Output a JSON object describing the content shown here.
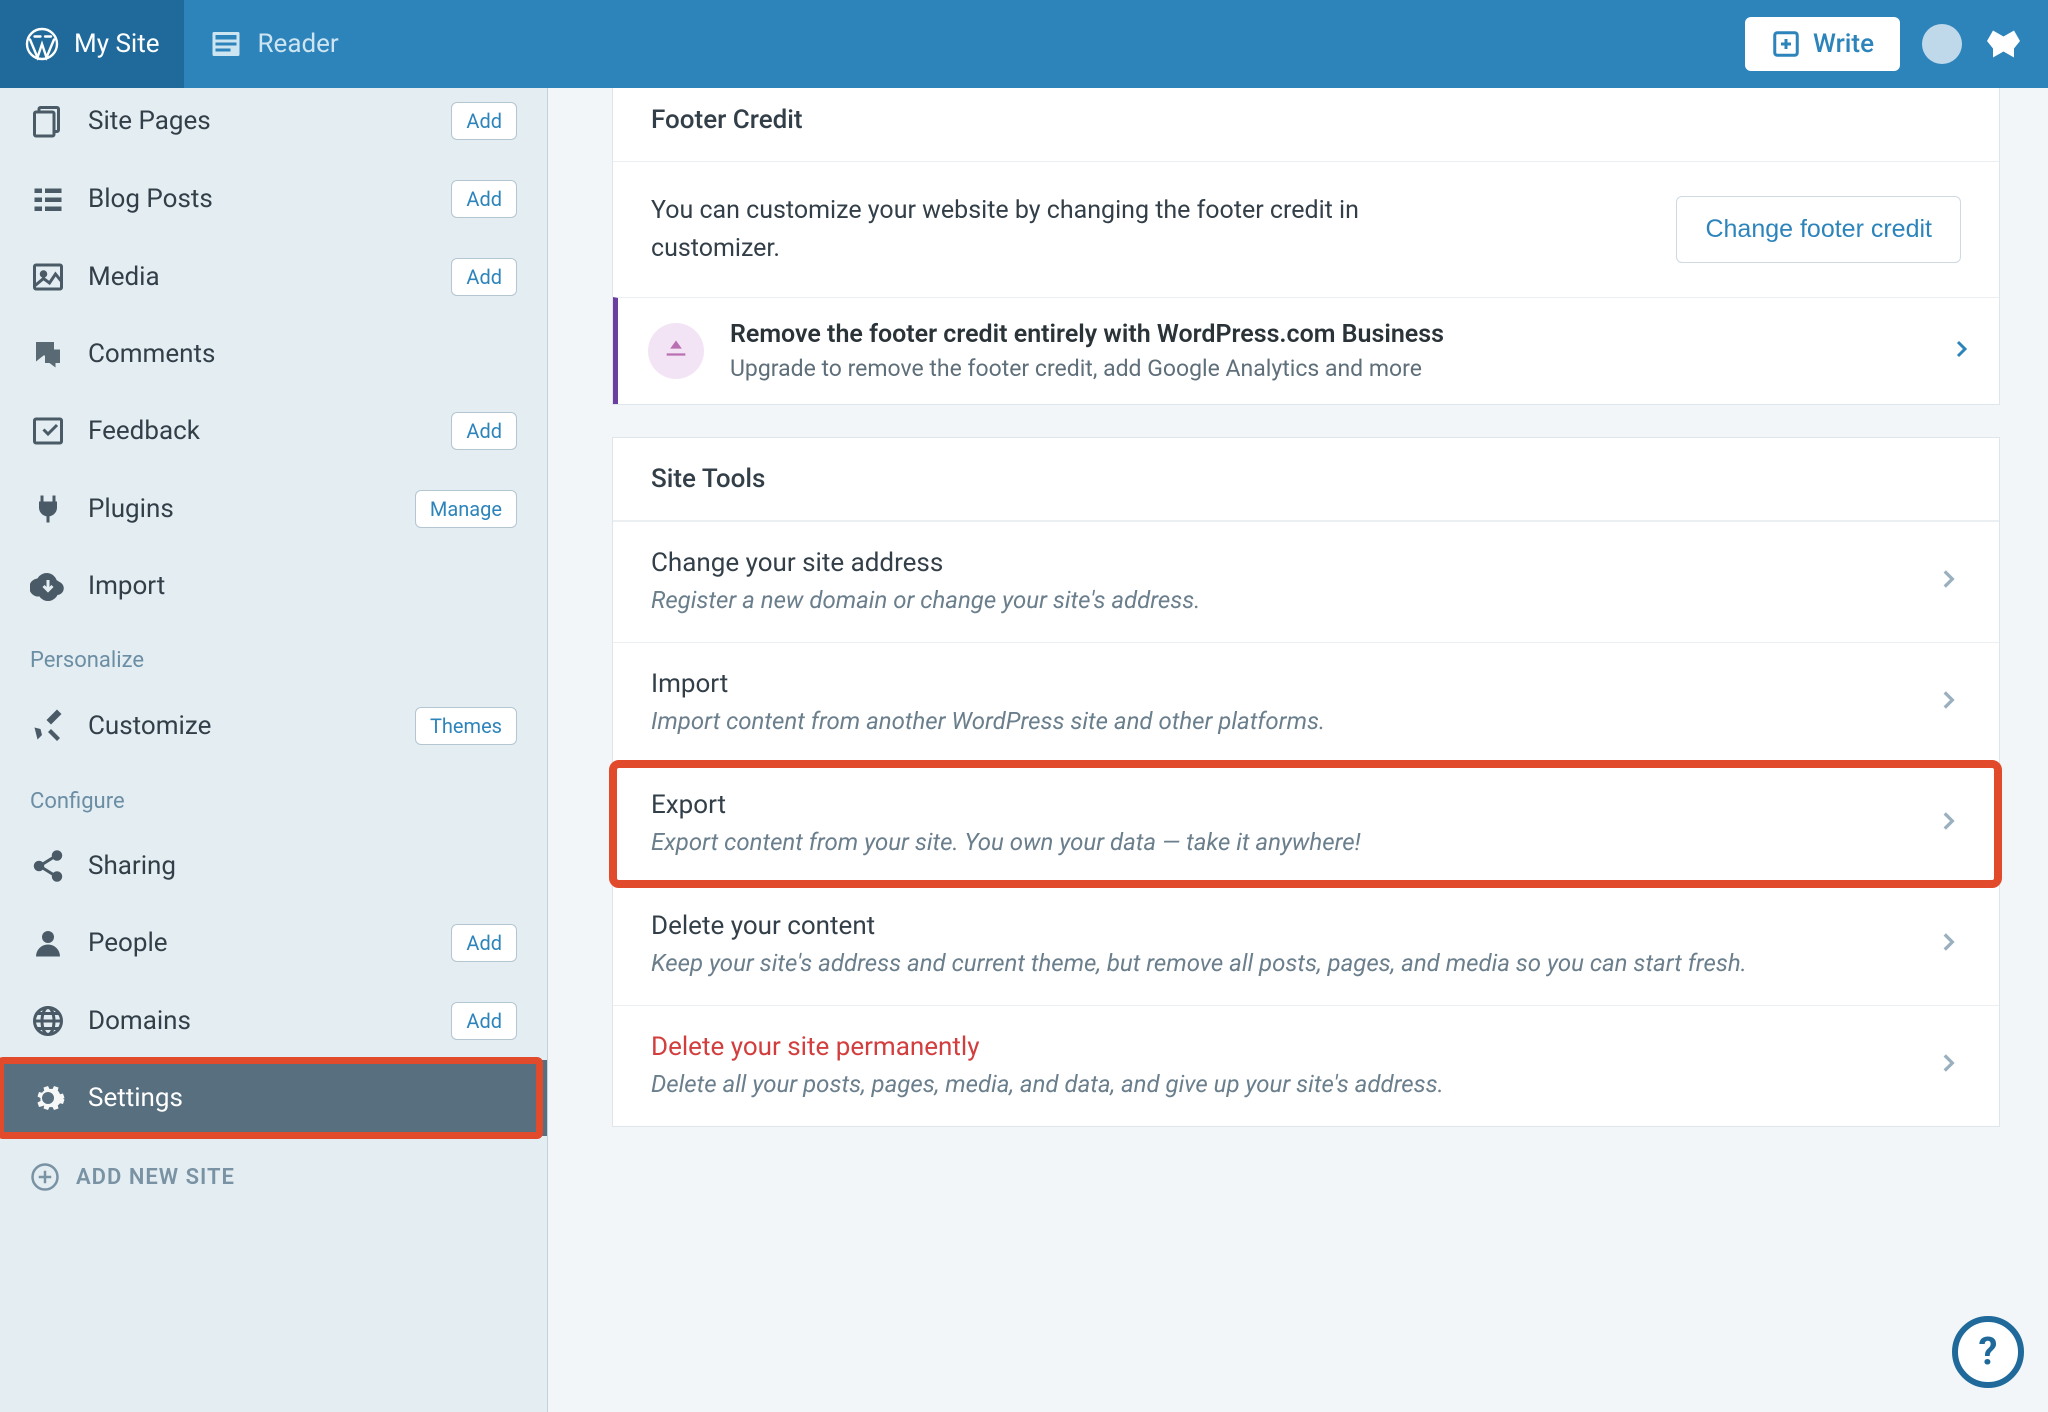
{
  "masterbar": {
    "mysite": "My Site",
    "reader": "Reader",
    "write": "Write"
  },
  "sidebar": {
    "items": [
      {
        "label": "Site Pages",
        "pill": "Add"
      },
      {
        "label": "Blog Posts",
        "pill": "Add"
      },
      {
        "label": "Media",
        "pill": "Add"
      },
      {
        "label": "Comments"
      },
      {
        "label": "Feedback",
        "pill": "Add"
      },
      {
        "label": "Plugins",
        "pill": "Manage"
      },
      {
        "label": "Import"
      }
    ],
    "personalize_title": "Personalize",
    "customize": {
      "label": "Customize",
      "pill": "Themes"
    },
    "configure_title": "Configure",
    "configure": [
      {
        "label": "Sharing"
      },
      {
        "label": "People",
        "pill": "Add"
      },
      {
        "label": "Domains",
        "pill": "Add"
      },
      {
        "label": "Settings"
      }
    ],
    "addnewsite": "ADD NEW SITE"
  },
  "footer_card": {
    "title": "Footer Credit",
    "body": "You can customize your website by changing the footer credit in customizer.",
    "btn": "Change footer credit",
    "upsell_title": "Remove the footer credit entirely with WordPress.com Business",
    "upsell_sub": "Upgrade to remove the footer credit, add Google Analytics and more"
  },
  "tools_card": {
    "title": "Site Tools",
    "rows": [
      {
        "title": "Change your site address",
        "sub": "Register a new domain or change your site's address."
      },
      {
        "title": "Import",
        "sub": "Import content from another WordPress site and other platforms."
      },
      {
        "title": "Export",
        "sub": "Export content from your site. You own your data — take it anywhere!"
      },
      {
        "title": "Delete your content",
        "sub": "Keep your site's address and current theme, but remove all posts, pages, and media so you can start fresh."
      },
      {
        "title": "Delete your site permanently",
        "sub": "Delete all your posts, pages, media, and data, and give up your site's address.",
        "danger": true
      }
    ]
  }
}
